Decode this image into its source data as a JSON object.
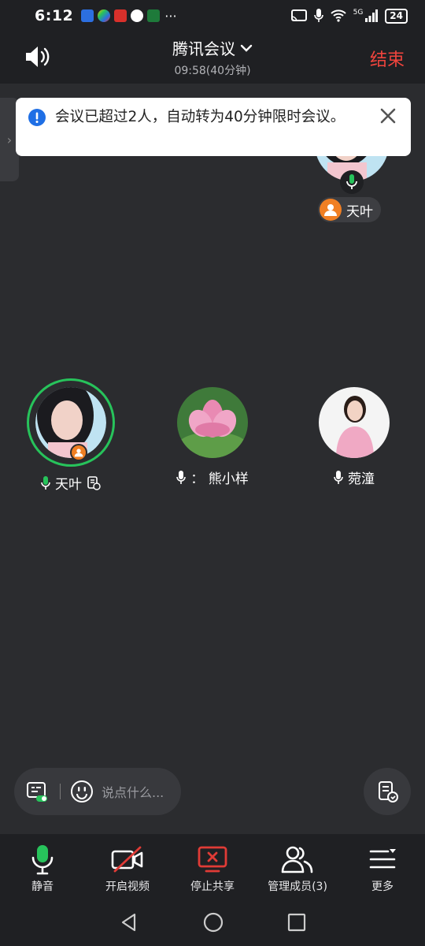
{
  "status_bar": {
    "time": "6:12",
    "more": "···",
    "network": "5G",
    "battery": "24"
  },
  "header": {
    "title": "腾讯会议",
    "timer": "09:58(40分钟)",
    "end_label": "结束"
  },
  "notice": {
    "text": "会议已超过2人，自动转为40分钟限时会议。"
  },
  "floating_speaker": {
    "name": "天叶"
  },
  "participants": [
    {
      "name": "天叶",
      "speaking": true,
      "host": true
    },
    {
      "name": "：  熊小样",
      "speaking": false,
      "host": false
    },
    {
      "name": "菀潼",
      "speaking": false,
      "host": false
    }
  ],
  "chat": {
    "placeholder": "说点什么..."
  },
  "toolbar": {
    "mute_label": "静音",
    "video_label": "开启视频",
    "share_label": "停止共享",
    "members_label": "管理成员(3)",
    "more_label": "更多"
  },
  "colors": {
    "end": "#f0443d",
    "speaking": "#27c35b",
    "host": "#f07f23",
    "share_stop": "#e03b36"
  }
}
